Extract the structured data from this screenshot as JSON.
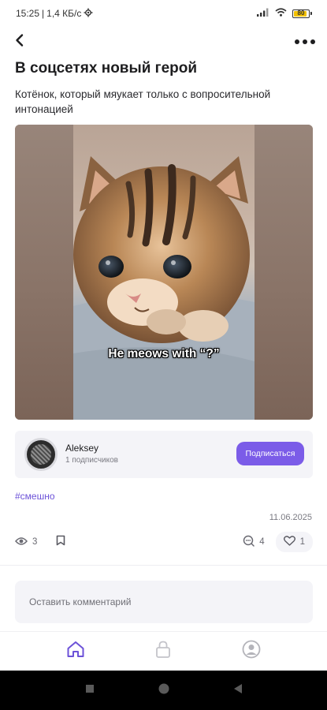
{
  "status_bar": {
    "time": "15:25",
    "separator": "|",
    "speed": "1,4 КБ/с",
    "battery_level": "80",
    "battery_fraction": 0.8
  },
  "post": {
    "title": "В соцсетях новый герой",
    "subtitle": "Котёнок, который мяукает только с вопросительной интонацией",
    "video_caption": "He meows with “?”",
    "hashtag": "#смешно",
    "date": "11.06.2025",
    "views": "3",
    "comments_count": "4",
    "likes_count": "1"
  },
  "author": {
    "name": "Aleksey",
    "subscribers": "1  подписчиков",
    "subscribe_label": "Подписаться"
  },
  "comment": {
    "placeholder": "Оставить комментарий"
  },
  "colors": {
    "accent": "#7b5ce8",
    "hashtag": "#6c52d8",
    "card_bg": "#f4f4f8"
  },
  "icons": {
    "back": "back-arrow-icon",
    "menu": "more-dots-icon",
    "views": "eye-icon",
    "bookmark": "bookmark-icon",
    "comments": "comment-icon",
    "likes": "heart-icon",
    "tab_home": "home-icon",
    "tab_lock": "lock-icon",
    "tab_profile": "profile-icon"
  }
}
